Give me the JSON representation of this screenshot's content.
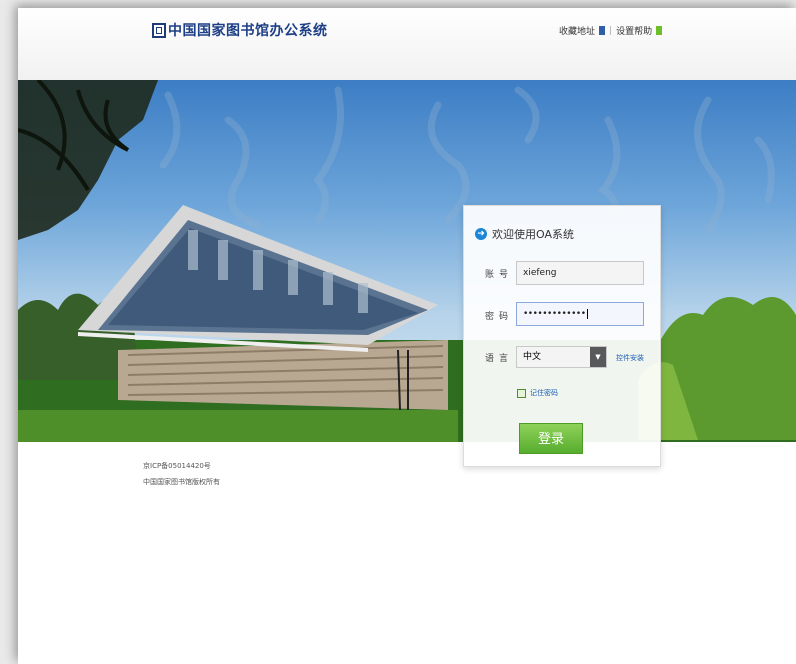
{
  "header": {
    "title": "中国国家图书馆办公系统",
    "links": [
      "收藏地址",
      "设置帮助"
    ],
    "separator": "|",
    "icons": [
      "bookmark-icon",
      "help-icon"
    ]
  },
  "footer": {
    "icp": "京ICP备05014420号",
    "copyright": "中国国家图书馆版权所有"
  },
  "login": {
    "title": "欢迎使用OA系统",
    "account_label": "账号",
    "account_value": "xiefeng",
    "password_label": "密码",
    "password_value": "•••••••••••••",
    "language_label": "语言",
    "language_value": "中文",
    "plugin_link": "控件安装",
    "remember_label": "记住密码",
    "submit_label": "登录"
  },
  "colors": {
    "brand": "#1d3f86",
    "link": "#1b5fb3",
    "login_button": "#6cbf3a"
  }
}
